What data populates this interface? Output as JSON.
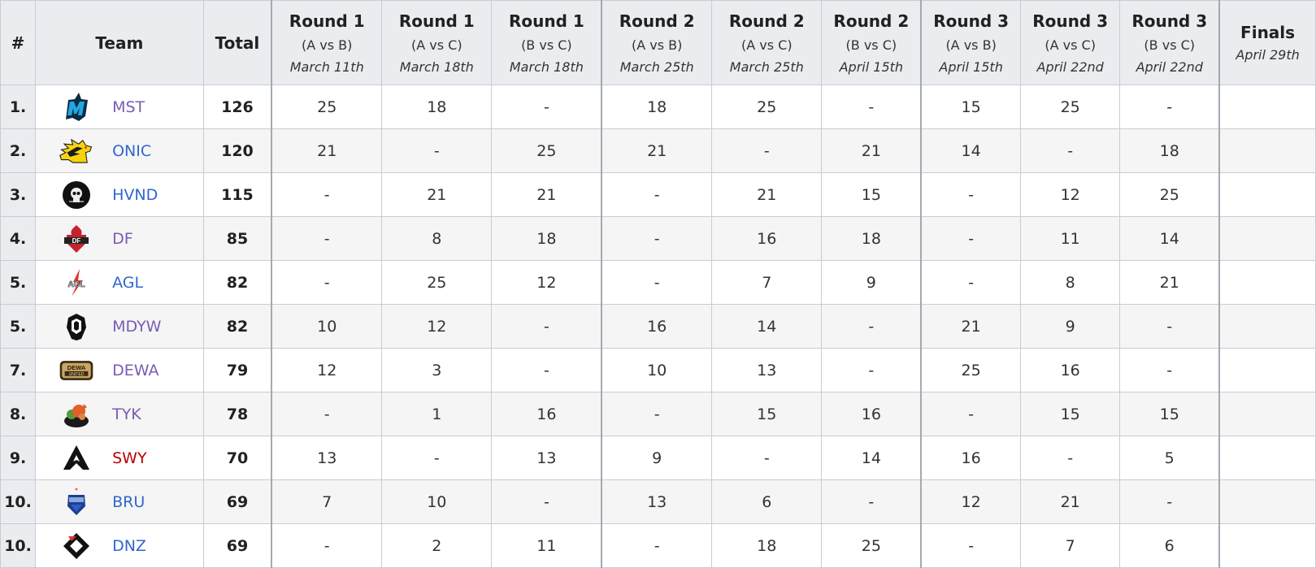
{
  "header": {
    "rank": "#",
    "team": "Team",
    "total": "Total",
    "rounds": [
      {
        "round": "Round 1",
        "match": "(A vs B)",
        "date": "March 11th"
      },
      {
        "round": "Round 1",
        "match": "(A vs C)",
        "date": "March 18th"
      },
      {
        "round": "Round 1",
        "match": "(B vs C)",
        "date": "March 18th"
      },
      {
        "round": "Round 2",
        "match": "(A vs B)",
        "date": "March 25th"
      },
      {
        "round": "Round 2",
        "match": "(A vs C)",
        "date": "March 25th"
      },
      {
        "round": "Round 2",
        "match": "(B vs C)",
        "date": "April 15th"
      },
      {
        "round": "Round 3",
        "match": "(A vs B)",
        "date": "April 15th"
      },
      {
        "round": "Round 3",
        "match": "(A vs C)",
        "date": "April 22nd"
      },
      {
        "round": "Round 3",
        "match": "(B vs C)",
        "date": "April 22nd"
      }
    ],
    "finals": {
      "round": "Finals",
      "date": "April 29th"
    }
  },
  "link_colors": {
    "visited": "#795cb2",
    "blue": "#3366cc",
    "new": "#ba0000"
  },
  "rows": [
    {
      "rank": "1.",
      "team": "MST",
      "logo": "mst-logo",
      "link": "visited",
      "total": "126",
      "scores": [
        "25",
        "18",
        "-",
        "18",
        "25",
        "-",
        "15",
        "25",
        "-"
      ],
      "finals": ""
    },
    {
      "rank": "2.",
      "team": "ONIC",
      "logo": "onic-logo",
      "link": "blue",
      "total": "120",
      "scores": [
        "21",
        "-",
        "25",
        "21",
        "-",
        "21",
        "14",
        "-",
        "18"
      ],
      "finals": ""
    },
    {
      "rank": "3.",
      "team": "HVND",
      "logo": "hvnd-logo",
      "link": "blue",
      "total": "115",
      "scores": [
        "-",
        "21",
        "21",
        "-",
        "21",
        "15",
        "-",
        "12",
        "25"
      ],
      "finals": ""
    },
    {
      "rank": "4.",
      "team": "DF",
      "logo": "df-logo",
      "link": "visited",
      "total": "85",
      "scores": [
        "-",
        "8",
        "18",
        "-",
        "16",
        "18",
        "-",
        "11",
        "14"
      ],
      "finals": ""
    },
    {
      "rank": "5.",
      "team": "AGL",
      "logo": "agl-logo",
      "link": "blue",
      "total": "82",
      "scores": [
        "-",
        "25",
        "12",
        "-",
        "7",
        "9",
        "-",
        "8",
        "21"
      ],
      "finals": ""
    },
    {
      "rank": "5.",
      "team": "MDYW",
      "logo": "mdyw-logo",
      "link": "visited",
      "total": "82",
      "scores": [
        "10",
        "12",
        "-",
        "16",
        "14",
        "-",
        "21",
        "9",
        "-"
      ],
      "finals": ""
    },
    {
      "rank": "7.",
      "team": "DEWA",
      "logo": "dewa-logo",
      "link": "visited",
      "total": "79",
      "scores": [
        "12",
        "3",
        "-",
        "10",
        "13",
        "-",
        "25",
        "16",
        "-"
      ],
      "finals": ""
    },
    {
      "rank": "8.",
      "team": "TYK",
      "logo": "tyk-logo",
      "link": "visited",
      "total": "78",
      "scores": [
        "-",
        "1",
        "16",
        "-",
        "15",
        "16",
        "-",
        "15",
        "15"
      ],
      "finals": ""
    },
    {
      "rank": "9.",
      "team": "SWY",
      "logo": "swy-logo",
      "link": "new",
      "total": "70",
      "scores": [
        "13",
        "-",
        "13",
        "9",
        "-",
        "14",
        "16",
        "-",
        "5"
      ],
      "finals": ""
    },
    {
      "rank": "10.",
      "team": "BRU",
      "logo": "bru-logo",
      "link": "blue",
      "total": "69",
      "scores": [
        "7",
        "10",
        "-",
        "13",
        "6",
        "-",
        "12",
        "21",
        "-"
      ],
      "finals": ""
    },
    {
      "rank": "10.",
      "team": "DNZ",
      "logo": "dnz-logo",
      "link": "blue",
      "total": "69",
      "scores": [
        "-",
        "2",
        "11",
        "-",
        "18",
        "25",
        "-",
        "7",
        "6"
      ],
      "finals": ""
    }
  ]
}
